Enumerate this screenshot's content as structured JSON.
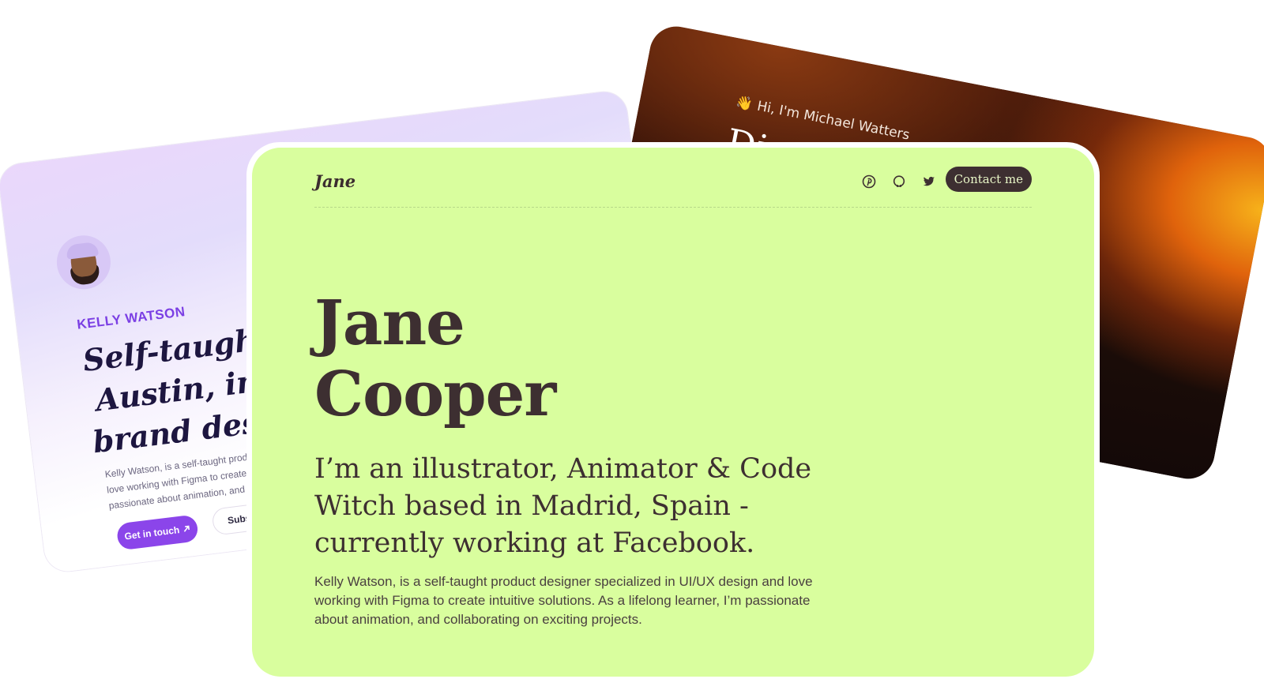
{
  "dark_card": {
    "greeting_emoji": "👋",
    "greeting": "Hi, I'm Michael Watters",
    "title": "Director, Prod"
  },
  "lavender_card": {
    "name": "KELLY WATSON",
    "headline": [
      "Self-taught P",
      "Austin, inter",
      "brand desig"
    ],
    "blurb": [
      "Kelly Watson, is a self-taught product",
      "love working with Figma to create int",
      "passionate about animation, and coll"
    ],
    "primary_button": "Get in touch",
    "primary_button_icon": "arrow-up-right-icon",
    "secondary_button": "Subscribe"
  },
  "front_card": {
    "logo": "Jane",
    "socials": [
      {
        "icon": "pinterest-icon"
      },
      {
        "icon": "github-icon"
      },
      {
        "icon": "twitter-icon"
      }
    ],
    "contact_button": "Contact me",
    "hero_name_line1": "Jane",
    "hero_name_line2": "Cooper",
    "tagline": "I’m an illustrator, Animator & Code Witch based in Madrid, Spain - currently working at Facebook.",
    "bio": "Kelly Watson, is a self-taught product designer specialized in UI/UX design and love working with Figma to create intuitive solutions. As a lifelong learner, I’m passionate about animation, and collaborating on exciting projects."
  },
  "colors": {
    "front_bg": "#d9fe9e",
    "ink": "#3d2f31",
    "lavender_accent": "#8b45ea",
    "dark_accent": "#e0630c"
  }
}
